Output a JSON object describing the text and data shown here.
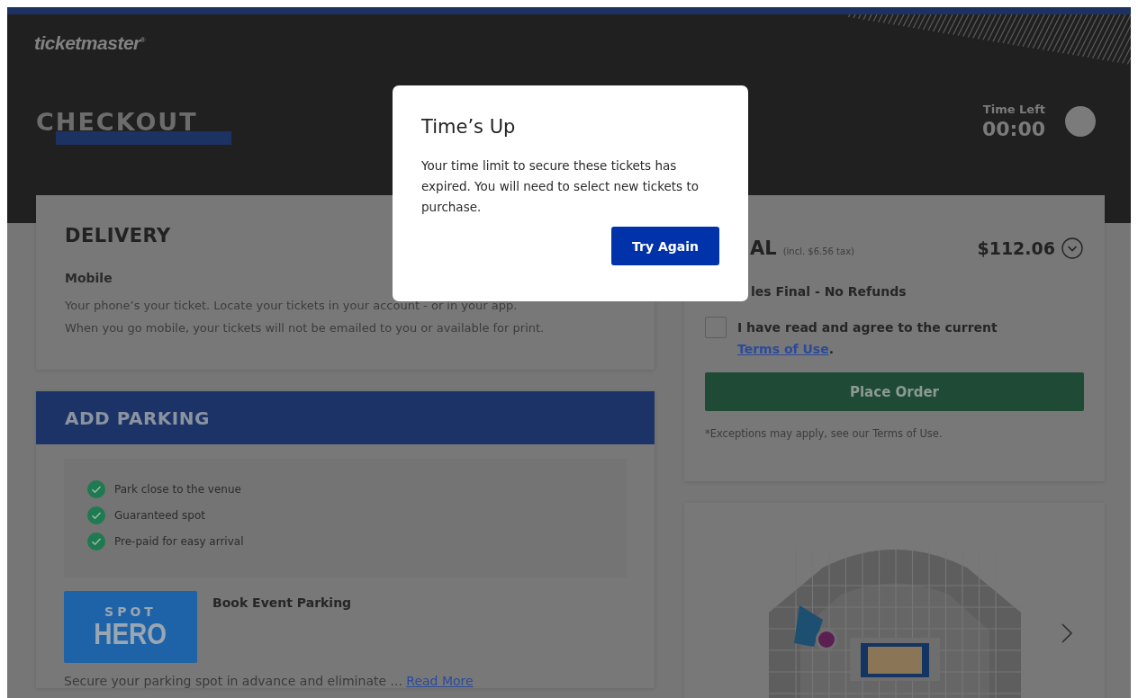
{
  "header": {
    "logo": "ticketmaster$^{®}$",
    "title": "CHECKOUT",
    "timer": {
      "label": "Time Left",
      "value": "00:00"
    }
  },
  "delivery": {
    "title": "DELIVERY",
    "method": "Mobile",
    "description": [
      "Your phone’s your ticket. Locate your tickets in your account - or in your app.",
      "When you go mobile, your tickets will not be emailed to you or available for print."
    ]
  },
  "parking": {
    "title": "ADD PARKING",
    "benefits": [
      {
        "text": "Park close to the venue",
        "checked": true
      },
      {
        "text": "Guaranteed spot",
        "checked": true
      },
      {
        "text": "Pre-paid for easy arrival",
        "checked": true
      }
    ],
    "provider": {
      "logo_top": "SPOT",
      "logo_bottom": "HERO",
      "title": "Book Event Parking",
      "description": "Secure your parking spot in advance and eliminate ... ",
      "link": "Read More"
    }
  },
  "order": {
    "total_label": "AL",
    "tax_note": "(incl. $6.56 tax)",
    "total": "$112.06",
    "expanded": false,
    "policy": "les Final - No Refunds",
    "terms": {
      "text": "I have read and agree to the current ",
      "link": "Terms of Use",
      "suffix": ".",
      "checked": false
    },
    "button": "Place Order",
    "note": "*Exceptions may apply, see our Terms of Use."
  },
  "modal": {
    "title": "Time’s Up",
    "message": "Your time limit to secure these tickets has expired. You will need to select new tickets to purchase.",
    "button": "Try Again"
  }
}
